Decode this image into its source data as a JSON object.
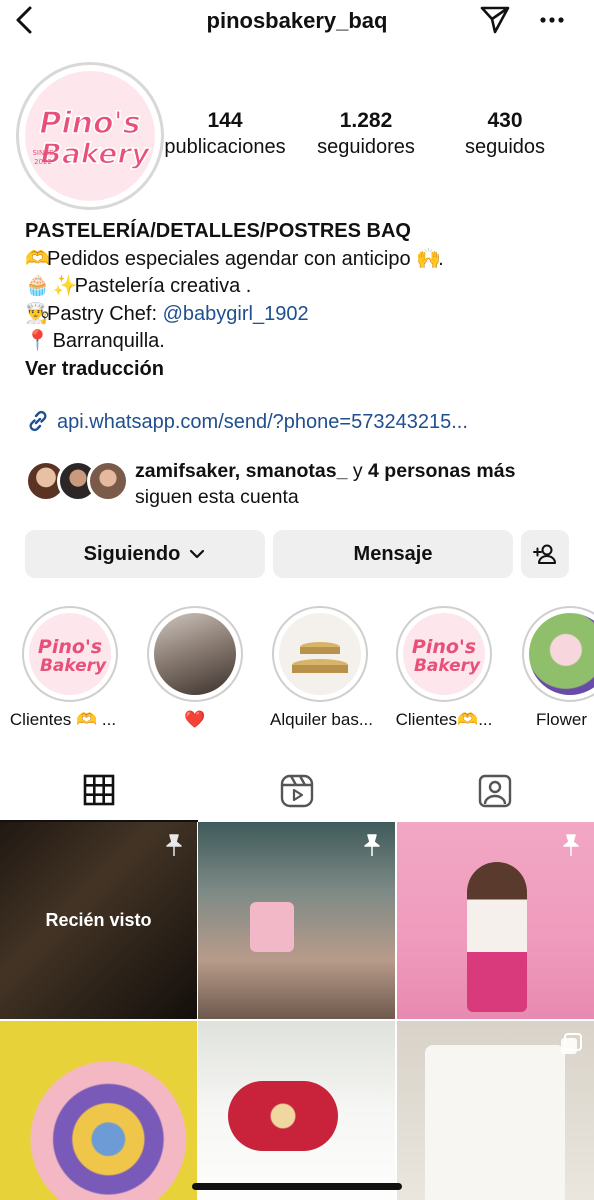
{
  "header": {
    "username": "pinosbakery_baq"
  },
  "profile": {
    "logo_text_1": "Pino's",
    "logo_text_2": "Bakery",
    "logo_since": "SINCE",
    "logo_year": "2022",
    "stats": [
      {
        "value": "144",
        "label": "publicaciones"
      },
      {
        "value": "1.282",
        "label": "seguidores"
      },
      {
        "value": "430",
        "label": "seguidos"
      }
    ]
  },
  "bio": {
    "name": "PASTELERÍA/DETALLES/POSTRES BAQ",
    "line1": "Pedidos especiales agendar con  anticipo",
    "line1_emoji_start": "🫶",
    "line1_emoji_end": "🙌",
    "line2_emoji_a": "🧁",
    "line2_emoji_b": "✨",
    "line2": "Pastelería creativa .",
    "line3_emoji": "👨‍🍳",
    "line3_text": "Pastry Chef: ",
    "line3_mention": "@babygirl_1902",
    "line4_emoji": "📍",
    "line4": "Barranquilla.",
    "translate": "Ver traducción",
    "link": "api.whatsapp.com/send/?phone=573243215..."
  },
  "followed_by": {
    "names": "zamifsaker, smanotas_",
    "connector": " y ",
    "more": "4 personas más",
    "line2": "siguen esta cuenta"
  },
  "actions": {
    "following": "Siguiendo",
    "message": "Mensaje"
  },
  "highlights": [
    {
      "label": "Clientes 🫶 ..."
    },
    {
      "label": "❤️"
    },
    {
      "label": "Alquiler bas..."
    },
    {
      "label": "Clientes🫶..."
    },
    {
      "label": "Flower"
    }
  ],
  "grid": {
    "recent_label": "Recién visto"
  },
  "colors": {
    "link_blue": "#1f4f8f",
    "button_bg": "#efefef",
    "logo_pink": "#e8507a"
  },
  "icons": [
    "back-chevron-icon",
    "send-icon",
    "more-icon",
    "link-icon",
    "add-user-icon",
    "grid-icon",
    "reels-icon",
    "tagged-icon",
    "pin-icon"
  ]
}
